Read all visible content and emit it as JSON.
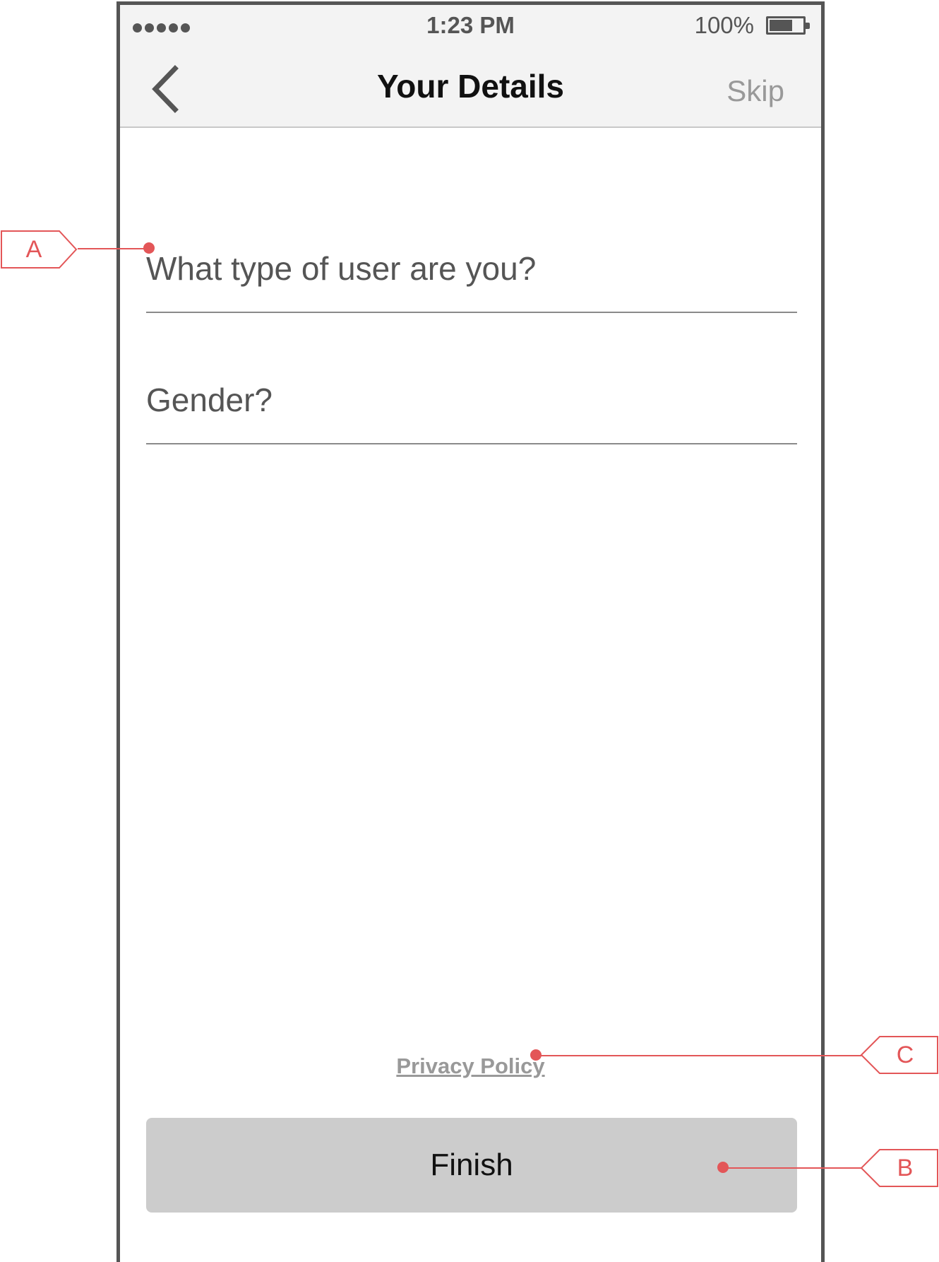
{
  "status_bar": {
    "signal_dots": 5,
    "time": "1:23 PM",
    "battery_percent": "100%",
    "battery_level": 0.7
  },
  "nav": {
    "back_icon": "chevron-left-icon",
    "title": "Your Details",
    "skip_label": "Skip"
  },
  "form": {
    "user_type_placeholder": "What type of user are you?",
    "gender_placeholder": "Gender?"
  },
  "footer": {
    "privacy_label": "Privacy Policy",
    "finish_label": "Finish"
  },
  "annotations": {
    "a": "A",
    "b": "B",
    "c": "C",
    "color": "#e35658"
  }
}
